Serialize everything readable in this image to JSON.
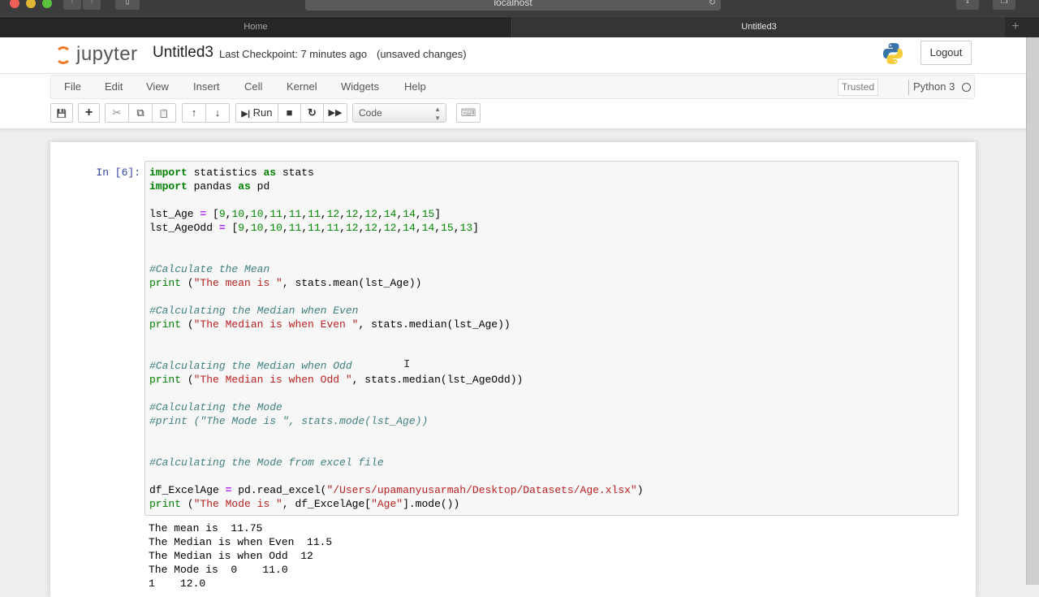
{
  "browser": {
    "url": "localhost",
    "tabs": [
      {
        "label": "Home",
        "active": false
      },
      {
        "label": "Untitled3",
        "active": true
      }
    ],
    "new_tab_icon": "+"
  },
  "header": {
    "logo_text": "jupyter",
    "notebook_title": "Untitled3",
    "checkpoint": "Last Checkpoint: 7 minutes ago",
    "save_status": "(unsaved changes)",
    "logout_label": "Logout"
  },
  "menubar": {
    "items": [
      "File",
      "Edit",
      "View",
      "Insert",
      "Cell",
      "Kernel",
      "Widgets",
      "Help"
    ],
    "trusted_label": "Trusted",
    "kernel_name": "Python 3"
  },
  "toolbar": {
    "run_label": "Run",
    "cell_type": "Code",
    "icons": {
      "save": "💾",
      "add": "+",
      "cut": "✂",
      "copy": "⧉",
      "paste": "📋",
      "up": "🡅",
      "down": "🡇",
      "stop": "■",
      "restart": "↻",
      "fast_forward": "⏩",
      "keyboard": "⌨"
    }
  },
  "cell": {
    "prompt": "In [6]:",
    "code_lines": [
      [
        {
          "t": "import",
          "c": "kw"
        },
        {
          "t": " statistics "
        },
        {
          "t": "as",
          "c": "kw"
        },
        {
          "t": " stats"
        }
      ],
      [
        {
          "t": "import",
          "c": "kw"
        },
        {
          "t": " pandas "
        },
        {
          "t": "as",
          "c": "kw"
        },
        {
          "t": " pd"
        }
      ],
      [],
      [
        {
          "t": "lst_Age "
        },
        {
          "t": "=",
          "c": "op"
        },
        {
          "t": " ["
        },
        {
          "t": "9",
          "c": "num"
        },
        {
          "t": ","
        },
        {
          "t": "10",
          "c": "num"
        },
        {
          "t": ","
        },
        {
          "t": "10",
          "c": "num"
        },
        {
          "t": ","
        },
        {
          "t": "11",
          "c": "num"
        },
        {
          "t": ","
        },
        {
          "t": "11",
          "c": "num"
        },
        {
          "t": ","
        },
        {
          "t": "11",
          "c": "num"
        },
        {
          "t": ","
        },
        {
          "t": "12",
          "c": "num"
        },
        {
          "t": ","
        },
        {
          "t": "12",
          "c": "num"
        },
        {
          "t": ","
        },
        {
          "t": "12",
          "c": "num"
        },
        {
          "t": ","
        },
        {
          "t": "14",
          "c": "num"
        },
        {
          "t": ","
        },
        {
          "t": "14",
          "c": "num"
        },
        {
          "t": ","
        },
        {
          "t": "15",
          "c": "num"
        },
        {
          "t": "]"
        }
      ],
      [
        {
          "t": "lst_AgeOdd "
        },
        {
          "t": "=",
          "c": "op"
        },
        {
          "t": " ["
        },
        {
          "t": "9",
          "c": "num"
        },
        {
          "t": ","
        },
        {
          "t": "10",
          "c": "num"
        },
        {
          "t": ","
        },
        {
          "t": "10",
          "c": "num"
        },
        {
          "t": ","
        },
        {
          "t": "11",
          "c": "num"
        },
        {
          "t": ","
        },
        {
          "t": "11",
          "c": "num"
        },
        {
          "t": ","
        },
        {
          "t": "11",
          "c": "num"
        },
        {
          "t": ","
        },
        {
          "t": "12",
          "c": "num"
        },
        {
          "t": ","
        },
        {
          "t": "12",
          "c": "num"
        },
        {
          "t": ","
        },
        {
          "t": "12",
          "c": "num"
        },
        {
          "t": ","
        },
        {
          "t": "14",
          "c": "num"
        },
        {
          "t": ","
        },
        {
          "t": "14",
          "c": "num"
        },
        {
          "t": ","
        },
        {
          "t": "15",
          "c": "num"
        },
        {
          "t": ","
        },
        {
          "t": "13",
          "c": "num"
        },
        {
          "t": "]"
        }
      ],
      [],
      [],
      [
        {
          "t": "#Calculate the Mean",
          "c": "cmt"
        }
      ],
      [
        {
          "t": "print",
          "c": "bi"
        },
        {
          "t": " ("
        },
        {
          "t": "\"The mean is \"",
          "c": "str"
        },
        {
          "t": ", stats.mean(lst_Age))"
        }
      ],
      [],
      [
        {
          "t": "#Calculating the Median when Even",
          "c": "cmt"
        }
      ],
      [
        {
          "t": "print",
          "c": "bi"
        },
        {
          "t": " ("
        },
        {
          "t": "\"The Median is when Even \"",
          "c": "str"
        },
        {
          "t": ", stats.median(lst_Age))"
        }
      ],
      [],
      [],
      [
        {
          "t": "#Calculating the Median when Odd",
          "c": "cmt"
        }
      ],
      [
        {
          "t": "print",
          "c": "bi"
        },
        {
          "t": " ("
        },
        {
          "t": "\"The Median is when Odd \"",
          "c": "str"
        },
        {
          "t": ", stats.median(lst_AgeOdd))"
        }
      ],
      [],
      [
        {
          "t": "#Calculating the Mode",
          "c": "cmt"
        }
      ],
      [
        {
          "t": "#print (\"The Mode is \", stats.mode(lst_Age))",
          "c": "cmt"
        }
      ],
      [],
      [],
      [
        {
          "t": "#Calculating the Mode from excel file",
          "c": "cmt"
        }
      ],
      [],
      [
        {
          "t": "df_ExcelAge "
        },
        {
          "t": "=",
          "c": "op"
        },
        {
          "t": " pd.read_excel("
        },
        {
          "t": "\"/Users/upamanyusarmah/Desktop/Datasets/Age.xlsx\"",
          "c": "str"
        },
        {
          "t": ")"
        }
      ],
      [
        {
          "t": "print",
          "c": "bi"
        },
        {
          "t": " ("
        },
        {
          "t": "\"The Mode is \"",
          "c": "str"
        },
        {
          "t": ", df_ExcelAge["
        },
        {
          "t": "\"Age\"",
          "c": "str"
        },
        {
          "t": "].mode())"
        }
      ]
    ],
    "output_lines": [
      "The mean is  11.75",
      "The Median is when Even  11.5",
      "The Median is when Odd  12",
      "The Mode is  0    11.0",
      "1    12.0"
    ]
  }
}
